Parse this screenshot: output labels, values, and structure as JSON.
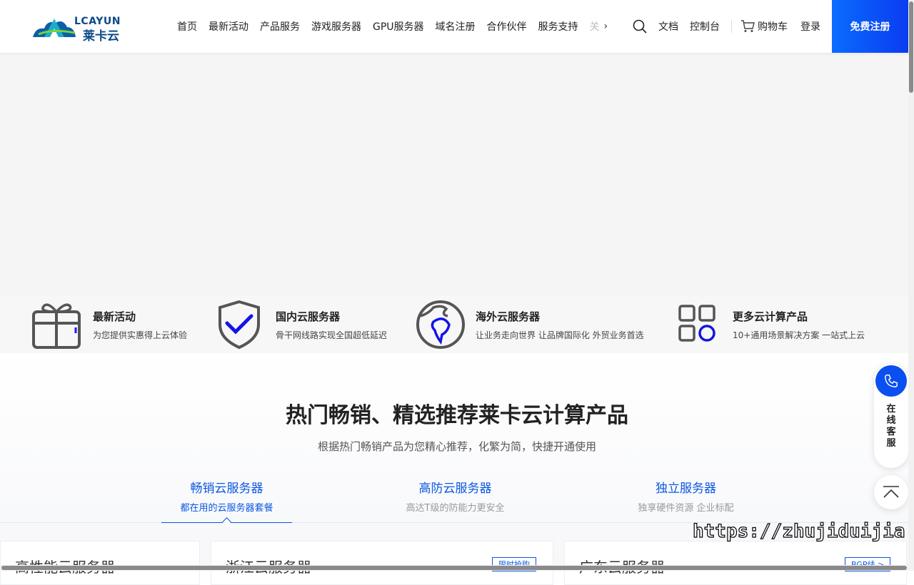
{
  "header": {
    "logo_en": "LCAYUN",
    "logo_cn": "莱卡云",
    "nav": [
      "首页",
      "最新活动",
      "产品服务",
      "游戏服务器",
      "GPU服务器",
      "域名注册",
      "合作伙伴",
      "服务支持"
    ],
    "nav_fade": "关",
    "docs": "文档",
    "console": "控制台",
    "cart": "购物车",
    "login": "登录",
    "register": "免费注册"
  },
  "features": [
    {
      "icon": "gift-icon",
      "title": "最新活动",
      "desc": "为您提供实惠得上云体验"
    },
    {
      "icon": "shield-check-icon",
      "title": "国内云服务器",
      "desc": "骨干网线路实现全国超低延迟"
    },
    {
      "icon": "globe-icon",
      "title": "海外云服务器",
      "desc": "让业务走向世界 让品牌国际化 外贸业务首选"
    },
    {
      "icon": "grid-apps-icon",
      "title": "更多云计算产品",
      "desc": "10+通用场景解决方案 一站式上云"
    }
  ],
  "section": {
    "title": "热门畅销、精选推荐莱卡云计算产品",
    "subtitle": "根据热门畅销产品为您精心推荐，化繁为简，快捷开通使用",
    "tabs": [
      {
        "label": "畅销云服务器",
        "desc": "都在用的云服务器套餐",
        "active": true
      },
      {
        "label": "高防云服务器",
        "desc": "高达T级的防能力更安全",
        "active": false
      },
      {
        "label": "独立服务器",
        "desc": "独享硬件资源 企业标配",
        "active": false
      }
    ],
    "cards": [
      {
        "title": "高性能云服务器",
        "badge": ""
      },
      {
        "title": "浙江云服务器",
        "badge": "限时抢购"
      },
      {
        "title": "广东云服务器",
        "badge": "BGP线 >"
      }
    ]
  },
  "float": {
    "service": "在线客服",
    "back_top": "back-to-top"
  },
  "watermark": "https://zhujiduijia.com",
  "colors": {
    "accent": "#0a56e0",
    "brand": "#0a4a8a"
  }
}
